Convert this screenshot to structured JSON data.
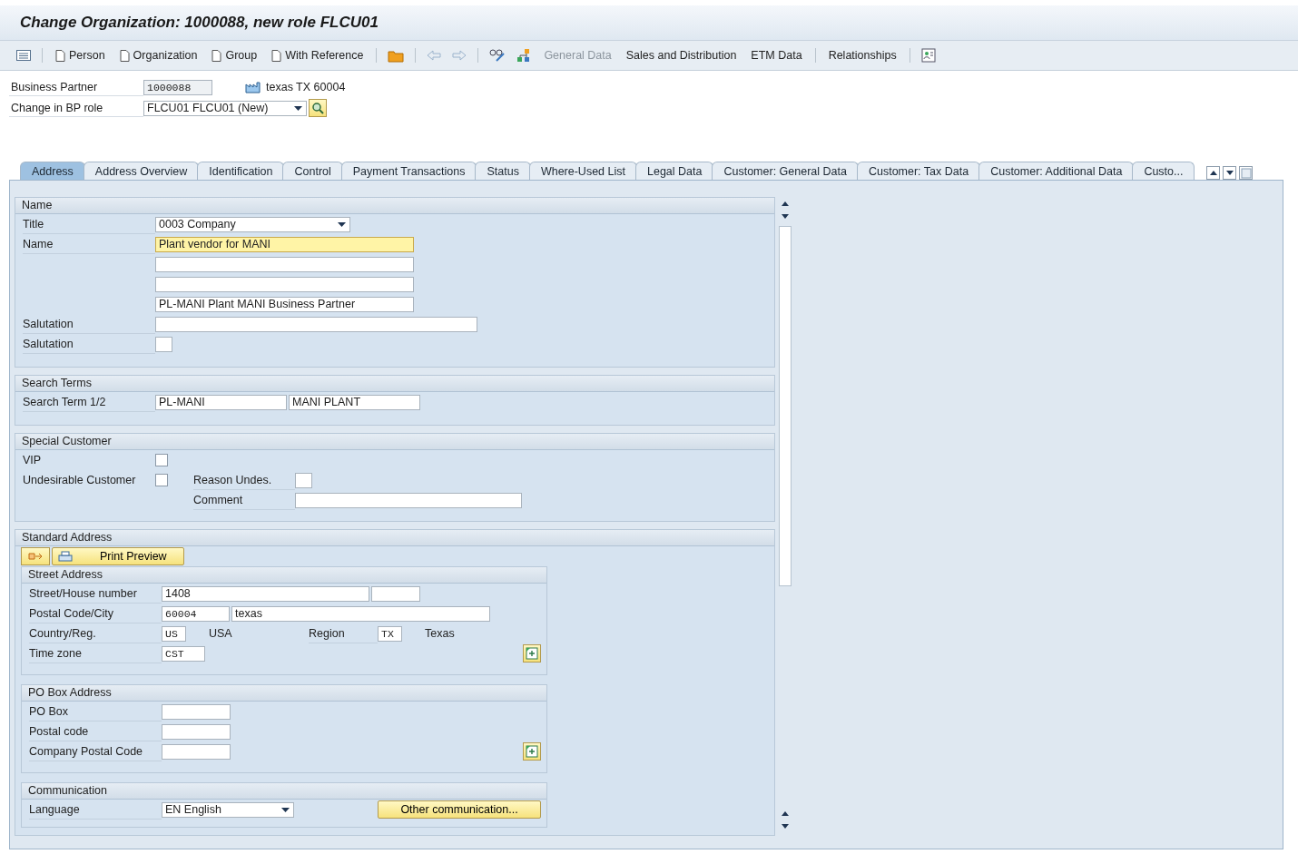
{
  "window": {
    "title": "Change Organization: 1000088, new role FLCU01"
  },
  "toolbar": {
    "create_buttons": [
      {
        "label": "Person"
      },
      {
        "label": "Organization"
      },
      {
        "label": "Group"
      },
      {
        "label": "With Reference"
      }
    ],
    "nav_buttons": [
      {
        "label": "General Data",
        "disabled": true
      },
      {
        "label": "Sales and Distribution",
        "disabled": false
      },
      {
        "label": "ETM Data",
        "disabled": false
      },
      {
        "label": "Relationships",
        "disabled": false
      }
    ]
  },
  "header": {
    "business_partner": {
      "label": "Business Partner",
      "value": "1000088",
      "address": "texas TX 60004"
    },
    "bp_role": {
      "label": "Change in BP role",
      "value": "FLCU01 FLCU01 (New)"
    }
  },
  "tabs": [
    {
      "label": "Address",
      "selected": true
    },
    {
      "label": "Address Overview",
      "selected": false
    },
    {
      "label": "Identification",
      "selected": false
    },
    {
      "label": "Control",
      "selected": false
    },
    {
      "label": "Payment Transactions",
      "selected": false
    },
    {
      "label": "Status",
      "selected": false
    },
    {
      "label": "Where-Used List",
      "selected": false
    },
    {
      "label": "Legal Data",
      "selected": false
    },
    {
      "label": "Customer: General Data",
      "selected": false
    },
    {
      "label": "Customer: Tax Data",
      "selected": false
    },
    {
      "label": "Customer: Additional Data",
      "selected": false
    },
    {
      "label": "Custo...",
      "selected": false
    }
  ],
  "name_section": {
    "title": "Name",
    "title_field": {
      "label": "Title",
      "value": "0003 Company"
    },
    "name_field": {
      "label": "Name",
      "value": "Plant vendor for MANI",
      "focused": true
    },
    "name_lines": [
      {
        "value": "PL-MANI Plant MANI Business Partner"
      }
    ],
    "salutation": {
      "label": "Salutation"
    },
    "salutation_code": {
      "label": "Salutation"
    }
  },
  "search_terms": {
    "title": "Search Terms",
    "label": "Search Term 1/2",
    "values": [
      "PL-MANI",
      "MANI PLANT"
    ]
  },
  "special_customer": {
    "title": "Special Customer",
    "vip": {
      "label": "VIP",
      "checked": false
    },
    "undesirable": {
      "label": "Undesirable Customer",
      "checked": false
    },
    "reason": {
      "label": "Reason Undes."
    },
    "comment": {
      "label": "Comment"
    }
  },
  "standard_address": {
    "title": "Standard Address",
    "print_preview": "Print Preview",
    "street_address": {
      "title": "Street Address",
      "street": {
        "label": "Street/House number",
        "value": "1408"
      },
      "postal": {
        "label": "Postal Code/City",
        "code": "60004",
        "city": "texas"
      },
      "country": {
        "label": "Country/Reg.",
        "code": "US",
        "name": "USA"
      },
      "region": {
        "label": "Region",
        "code": "TX",
        "name": "Texas"
      },
      "time_zone": {
        "label": "Time zone",
        "value": "CST"
      }
    },
    "po_box": {
      "title": "PO Box Address",
      "fields": [
        {
          "label": "PO Box"
        },
        {
          "label": "Postal code"
        },
        {
          "label": "Company Postal Code"
        }
      ]
    },
    "communication": {
      "title": "Communication",
      "language": {
        "label": "Language",
        "value": "EN English"
      },
      "other_button": "Other communication..."
    }
  }
}
